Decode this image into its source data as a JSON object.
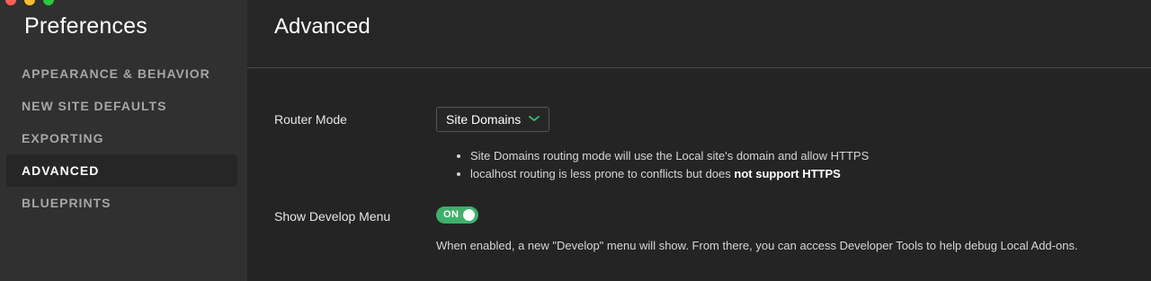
{
  "sidebar": {
    "title": "Preferences",
    "items": [
      {
        "label": "APPEARANCE & BEHAVIOR"
      },
      {
        "label": "NEW SITE DEFAULTS"
      },
      {
        "label": "EXPORTING"
      },
      {
        "label": "ADVANCED",
        "active": true
      },
      {
        "label": "BLUEPRINTS"
      }
    ]
  },
  "main": {
    "title": "Advanced",
    "router": {
      "label": "Router Mode",
      "selected": "Site Domains",
      "notes": [
        "Site Domains routing mode will use the Local site's domain and allow HTTPS",
        "localhost routing is less prone to conflicts but does",
        "not support HTTPS"
      ]
    },
    "develop": {
      "label": "Show Develop Menu",
      "toggle_label": "ON",
      "enabled": true,
      "description": "When enabled, a new \"Develop\" menu will show. From there, you can access Developer Tools to help debug Local Add-ons."
    }
  },
  "colors": {
    "accent": "#3fb06b",
    "sidebar_bg": "#303030",
    "main_bg": "#262626"
  },
  "icons": {
    "select_chevron": "chevron-down-icon"
  }
}
